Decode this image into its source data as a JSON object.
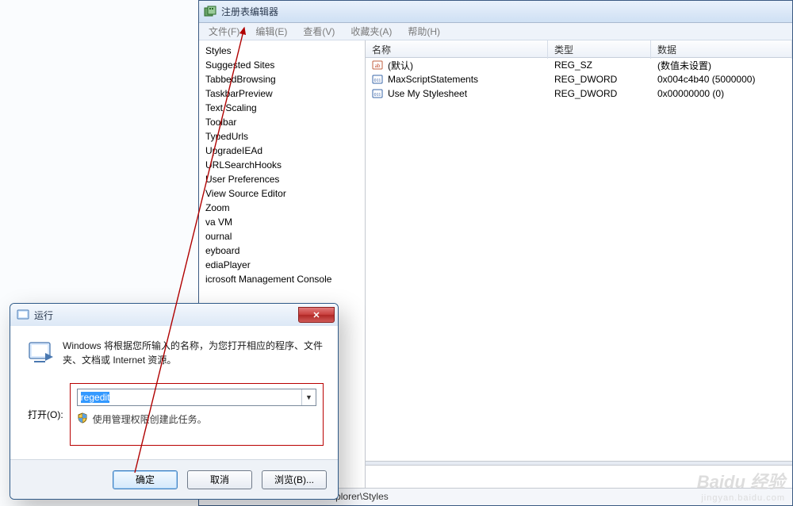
{
  "regedit": {
    "title": "注册表编辑器",
    "menus": {
      "file": "文件(F)",
      "edit": "编辑(E)",
      "view": "查看(V)",
      "favorites": "收藏夹(A)",
      "help": "帮助(H)"
    },
    "tree_items": [
      "Styles",
      "Suggested Sites",
      "TabbedBrowsing",
      "TaskbarPreview",
      "Text Scaling",
      "Toolbar",
      "TypedUrls",
      "UpgradeIEAd",
      "URLSearchHooks",
      "User Preferences",
      "View Source Editor",
      "Zoom",
      "va VM",
      "ournal",
      "eyboard",
      "ediaPlayer",
      "icrosoft Management Console"
    ],
    "columns": {
      "name": "名称",
      "type": "类型",
      "data": "数据"
    },
    "values": [
      {
        "icon": "string",
        "name": "(默认)",
        "type": "REG_SZ",
        "data": "(数值未设置)"
      },
      {
        "icon": "dword",
        "name": "MaxScriptStatements",
        "type": "REG_DWORD",
        "data": "0x004c4b40 (5000000)"
      },
      {
        "icon": "dword",
        "name": "Use My Stylesheet",
        "type": "REG_DWORD",
        "data": "0x00000000 (0)"
      }
    ],
    "statusbar": "\\Software\\Microsoft\\Internet Explorer\\Styles"
  },
  "run": {
    "title": "运行",
    "desc": "Windows 将根据您所输入的名称，为您打开相应的程序、文件夹、文档或 Internet 资源。",
    "open_label": "打开(O):",
    "input_value": "regedit",
    "shield_text": "使用管理权限创建此任务。",
    "buttons": {
      "ok": "确定",
      "cancel": "取消",
      "browse": "浏览(B)..."
    }
  },
  "watermark": {
    "line1": "Baidu 经验",
    "line2": "jingyan.baidu.com"
  }
}
